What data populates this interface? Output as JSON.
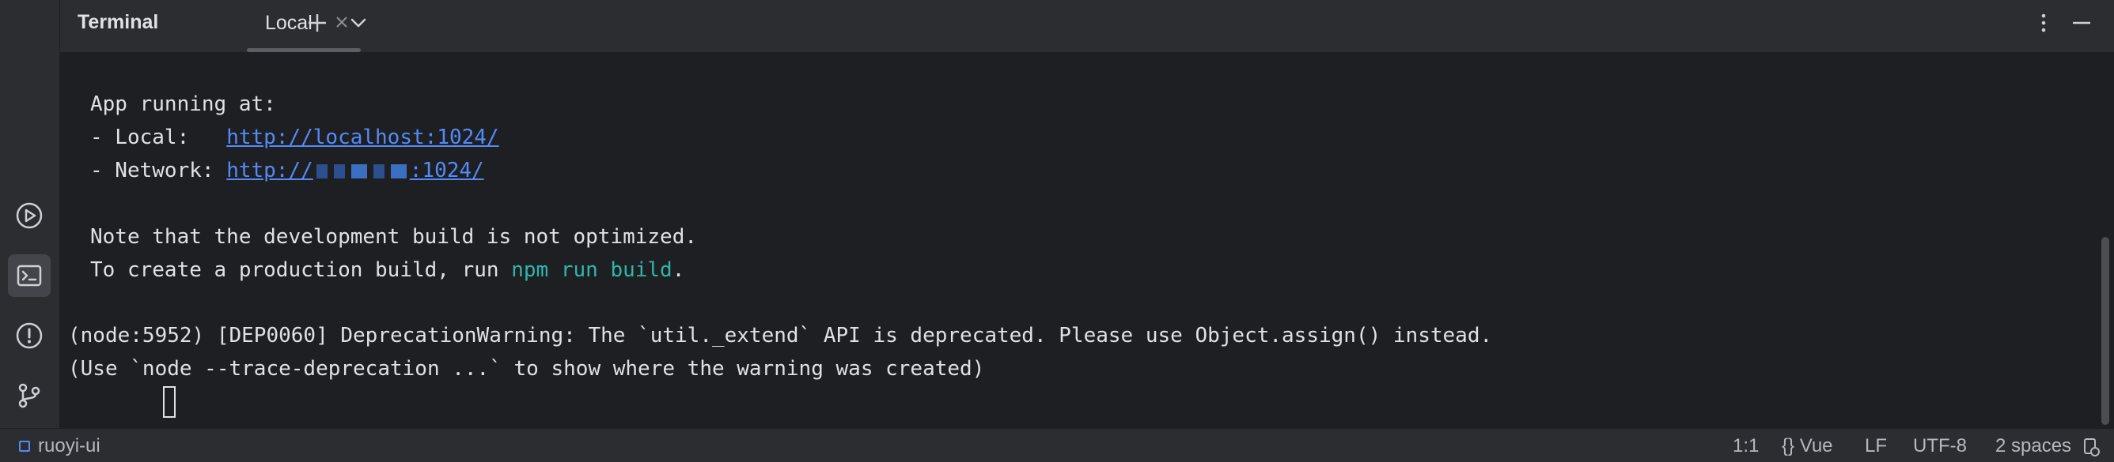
{
  "header": {
    "title": "Terminal",
    "tab_label": "Local"
  },
  "terminal": {
    "lines": [
      "App running at:",
      "- Local:   ",
      "http://localhost:1024/",
      "- Network: ",
      "http://",
      ":1024/",
      "Note that the development build is not optimized.",
      "To create a production build, run ",
      "npm run build",
      ".",
      "(node:5952) [DEP0060] DeprecationWarning: The `util._extend` API is deprecated. Please use Object.assign() instead.",
      "(Use `node --trace-deprecation ...` to show where the warning was created)"
    ]
  },
  "status": {
    "project": "ruoyi-ui",
    "position": "1:1",
    "language": "Vue",
    "line_ending": "LF",
    "encoding": "UTF-8",
    "indent": "2 spaces"
  },
  "colors": {
    "link": "#548af7",
    "command": "#2fb6ab",
    "background": "#1e1f22",
    "panel": "#2b2d30"
  }
}
